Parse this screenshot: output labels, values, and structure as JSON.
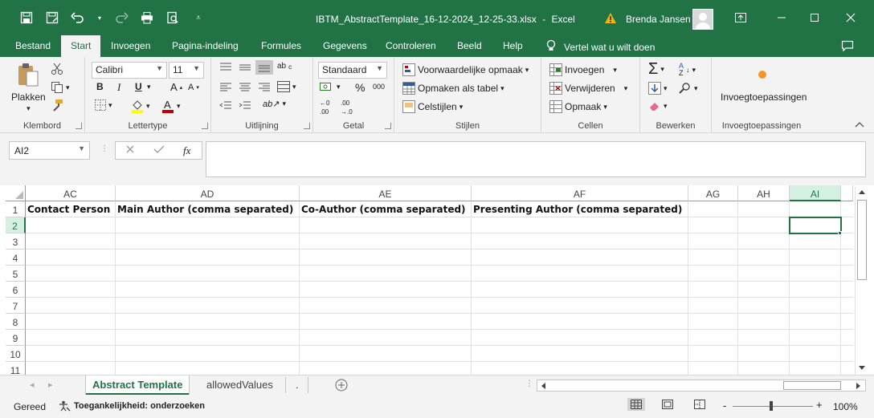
{
  "title": {
    "filename": "IBTM_AbstractTemplate_16-12-2024_12-25-33.xlsx",
    "separator": "-",
    "app": "Excel",
    "user": "Brenda Jansen"
  },
  "tabs": [
    "Bestand",
    "Start",
    "Invoegen",
    "Pagina-indeling",
    "Formules",
    "Gegevens",
    "Controleren",
    "Beeld",
    "Help"
  ],
  "tell_me": "Vertel wat u wilt doen",
  "ribbon": {
    "clipboard": {
      "paste": "Plakken",
      "label": "Klembord"
    },
    "font": {
      "name": "Calibri",
      "size": "11",
      "bold": "B",
      "italic": "I",
      "underline": "U",
      "label": "Lettertype"
    },
    "alignment": {
      "label": "Uitlijning"
    },
    "number": {
      "format": "Standaard",
      "percent": "%",
      "thousands": "000",
      "label": "Getal"
    },
    "styles": {
      "conditional": "Voorwaardelijke opmaak",
      "as_table": "Opmaken als tabel",
      "cell_styles": "Celstijlen",
      "label": "Stijlen"
    },
    "cells": {
      "insert": "Invoegen",
      "delete": "Verwijderen",
      "format": "Opmaak",
      "label": "Cellen"
    },
    "editing": {
      "label": "Bewerken"
    },
    "addins": {
      "button": "Invoegtoepassingen",
      "label": "Invoegtoepassingen"
    }
  },
  "formula_bar": {
    "name_box": "AI2",
    "fx": "fx",
    "formula": ""
  },
  "grid": {
    "columns": [
      "AC",
      "AD",
      "AE",
      "AF",
      "AG",
      "AH",
      "AI"
    ],
    "rows": [
      "1",
      "2",
      "3",
      "4",
      "5",
      "6",
      "7",
      "8",
      "9",
      "10",
      "11"
    ],
    "headers": [
      "Contact Person",
      "Main Author (comma separated)",
      "Co-Author (comma separated)",
      "Presenting Author (comma separated)"
    ],
    "active_cell": "AI2"
  },
  "sheets": [
    {
      "name": "Abstract Template",
      "active": true
    },
    {
      "name": "allowedValues",
      "active": false
    },
    {
      "name": ".",
      "active": false
    }
  ],
  "status": {
    "mode": "Gereed",
    "accessibility": "Toegankelijkheid: onderzoeken",
    "zoom": "100%",
    "minus": "-",
    "plus": "+"
  },
  "colors": {
    "brand": "#217346",
    "ribbon_bg": "#f3f3f3",
    "warning": "#f2b705",
    "font_red": "#c00000",
    "highlight_yellow": "#ffff00"
  }
}
